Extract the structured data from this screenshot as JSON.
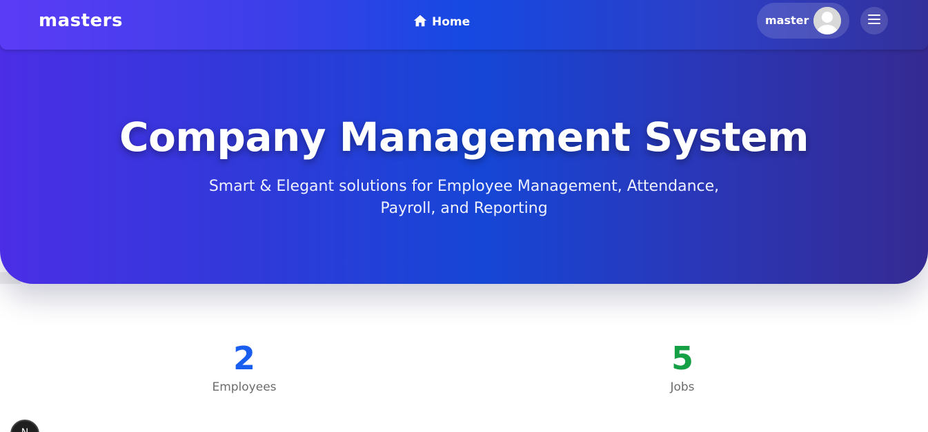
{
  "navbar": {
    "brand": "masters",
    "home_label": "Home",
    "user_name": "master"
  },
  "hero": {
    "title": "Company Management System",
    "subtitle": "Smart & Elegant solutions for Employee Management, Attendance, Payroll, and Reporting"
  },
  "stats": [
    {
      "value": "2",
      "label": "Employees",
      "color": "#1a5ef0"
    },
    {
      "value": "5",
      "label": "Jobs",
      "color": "#15a045"
    }
  ],
  "badge": {
    "label": "N"
  },
  "icons": {
    "home": "home-icon",
    "avatar": "user-avatar-icon",
    "menu": "hamburger-menu-icon"
  },
  "colors": {
    "accent_blue": "#1646d6",
    "accent_purple": "#4b2ee6"
  }
}
